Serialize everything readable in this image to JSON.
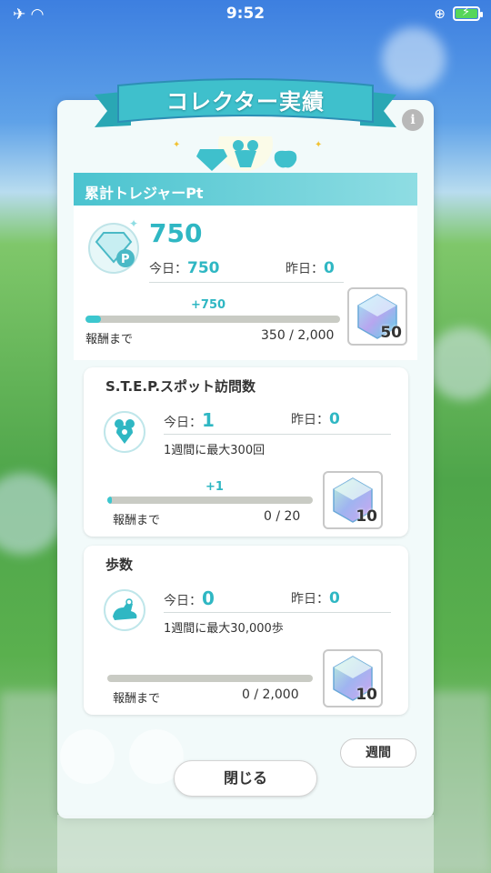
{
  "status_bar": {
    "time": "9:52"
  },
  "panel": {
    "title": "コレクター実績",
    "header": "累計トレジャーPt",
    "info": "i"
  },
  "treasure": {
    "value": "750",
    "today_label": "今日：",
    "today_value": "750",
    "yesterday_label": "昨日：",
    "yesterday_value": "0",
    "delta": "+750",
    "until_reward": "報酬まで",
    "progress": "350 / 2,000",
    "progress_fraction": 0.06,
    "reward_qty": "50"
  },
  "step_card": {
    "title": "S.T.E.P.スポット訪問数",
    "today_label": "今日：",
    "today_value": "1",
    "yesterday_label": "昨日：",
    "yesterday_value": "0",
    "note": "1週間に最大300回",
    "delta": "+1",
    "until_reward": "報酬まで",
    "progress": "0 / 20",
    "progress_fraction": 0.02,
    "reward_qty": "10"
  },
  "steps_card": {
    "title": "歩数",
    "today_label": "今日：",
    "today_value": "0",
    "yesterday_label": "昨日：",
    "yesterday_value": "0",
    "note": "1週間に最大30,000歩",
    "until_reward": "報酬まで",
    "progress": "0 / 2,000",
    "progress_fraction": 0,
    "reward_qty": "10"
  },
  "buttons": {
    "week": "週間",
    "close": "閉じる"
  },
  "colors": {
    "accent": "#2fb7c3",
    "ribbon": "#3fc0cc"
  }
}
